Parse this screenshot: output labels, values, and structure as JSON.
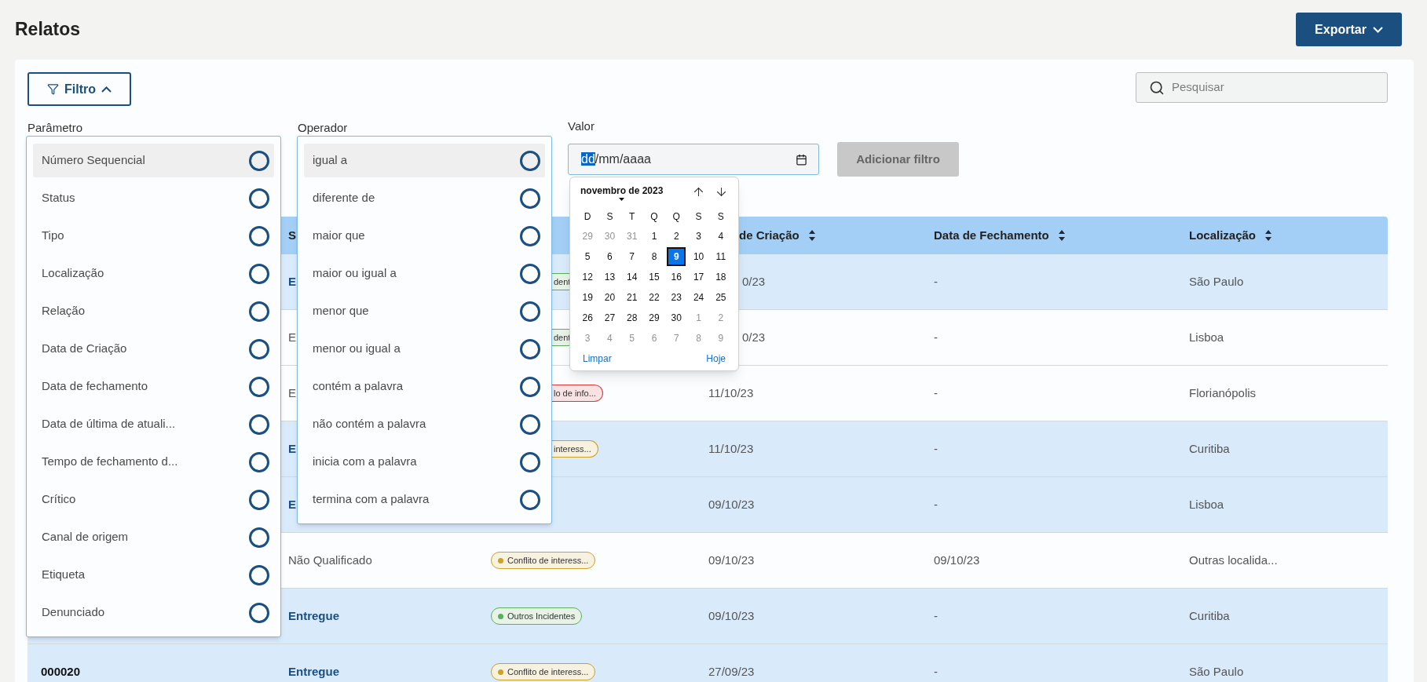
{
  "page": {
    "title": "Relatos"
  },
  "export_button": {
    "label": "Exportar"
  },
  "filter_button": {
    "label": "Filtro",
    "expanded": true
  },
  "search": {
    "placeholder": "Pesquisar"
  },
  "filter_form": {
    "parameter_label": "Parâmetro",
    "operator_label": "Operador",
    "value_label": "Valor",
    "value_segments": [
      {
        "text": "dd",
        "selected": true
      },
      {
        "text": "/mm/aaaa",
        "selected": false
      }
    ],
    "add_button": {
      "label": "Adicionar filtro",
      "disabled": true
    }
  },
  "parameter_menu": [
    {
      "label": "Número Sequencial",
      "highlighted": true,
      "selected": false
    },
    {
      "label": "Status",
      "highlighted": false,
      "selected": false
    },
    {
      "label": "Tipo",
      "highlighted": false,
      "selected": false
    },
    {
      "label": "Localização",
      "highlighted": false,
      "selected": false
    },
    {
      "label": "Relação",
      "highlighted": false,
      "selected": false
    },
    {
      "label": "Data de Criação",
      "highlighted": false,
      "selected": false
    },
    {
      "label": "Data de fechamento",
      "highlighted": false,
      "selected": false
    },
    {
      "label": "Data de última de atuali...",
      "highlighted": false,
      "selected": false
    },
    {
      "label": "Tempo de fechamento d...",
      "highlighted": false,
      "selected": false
    },
    {
      "label": "Crítico",
      "highlighted": false,
      "selected": false
    },
    {
      "label": "Canal de origem",
      "highlighted": false,
      "selected": false
    },
    {
      "label": "Etiqueta",
      "highlighted": false,
      "selected": false
    },
    {
      "label": "Denunciado",
      "highlighted": false,
      "selected": false
    }
  ],
  "operator_menu": [
    {
      "label": "igual a",
      "highlighted": true,
      "selected": false
    },
    {
      "label": "diferente de",
      "highlighted": false,
      "selected": false
    },
    {
      "label": "maior que",
      "highlighted": false,
      "selected": false
    },
    {
      "label": "maior ou igual a",
      "highlighted": false,
      "selected": false
    },
    {
      "label": "menor que",
      "highlighted": false,
      "selected": false
    },
    {
      "label": "menor ou igual a",
      "highlighted": false,
      "selected": false
    },
    {
      "label": "contém a palavra",
      "highlighted": false,
      "selected": false
    },
    {
      "label": "não contém a palavra",
      "highlighted": false,
      "selected": false
    },
    {
      "label": "inicia com a palavra",
      "highlighted": false,
      "selected": false
    },
    {
      "label": "termina com a palavra",
      "highlighted": false,
      "selected": false
    }
  ],
  "date_picker": {
    "month_label": "novembro de 2023",
    "weekdays": [
      "D",
      "S",
      "T",
      "Q",
      "Q",
      "S",
      "S"
    ],
    "weeks": [
      [
        {
          "day": "29",
          "outside_month": true,
          "selected": false
        },
        {
          "day": "30",
          "outside_month": true,
          "selected": false
        },
        {
          "day": "31",
          "outside_month": true,
          "selected": false
        },
        {
          "day": "1",
          "outside_month": false,
          "selected": false
        },
        {
          "day": "2",
          "outside_month": false,
          "selected": false
        },
        {
          "day": "3",
          "outside_month": false,
          "selected": false
        },
        {
          "day": "4",
          "outside_month": false,
          "selected": false
        }
      ],
      [
        {
          "day": "5",
          "outside_month": false,
          "selected": false
        },
        {
          "day": "6",
          "outside_month": false,
          "selected": false
        },
        {
          "day": "7",
          "outside_month": false,
          "selected": false
        },
        {
          "day": "8",
          "outside_month": false,
          "selected": false
        },
        {
          "day": "9",
          "outside_month": false,
          "selected": true
        },
        {
          "day": "10",
          "outside_month": false,
          "selected": false
        },
        {
          "day": "11",
          "outside_month": false,
          "selected": false
        }
      ],
      [
        {
          "day": "12",
          "outside_month": false,
          "selected": false
        },
        {
          "day": "13",
          "outside_month": false,
          "selected": false
        },
        {
          "day": "14",
          "outside_month": false,
          "selected": false
        },
        {
          "day": "15",
          "outside_month": false,
          "selected": false
        },
        {
          "day": "16",
          "outside_month": false,
          "selected": false
        },
        {
          "day": "17",
          "outside_month": false,
          "selected": false
        },
        {
          "day": "18",
          "outside_month": false,
          "selected": false
        }
      ],
      [
        {
          "day": "19",
          "outside_month": false,
          "selected": false
        },
        {
          "day": "20",
          "outside_month": false,
          "selected": false
        },
        {
          "day": "21",
          "outside_month": false,
          "selected": false
        },
        {
          "day": "22",
          "outside_month": false,
          "selected": false
        },
        {
          "day": "23",
          "outside_month": false,
          "selected": false
        },
        {
          "day": "24",
          "outside_month": false,
          "selected": false
        },
        {
          "day": "25",
          "outside_month": false,
          "selected": false
        }
      ],
      [
        {
          "day": "26",
          "outside_month": false,
          "selected": false
        },
        {
          "day": "27",
          "outside_month": false,
          "selected": false
        },
        {
          "day": "28",
          "outside_month": false,
          "selected": false
        },
        {
          "day": "29",
          "outside_month": false,
          "selected": false
        },
        {
          "day": "30",
          "outside_month": false,
          "selected": false
        },
        {
          "day": "1",
          "outside_month": true,
          "selected": false
        },
        {
          "day": "2",
          "outside_month": true,
          "selected": false
        }
      ],
      [
        {
          "day": "3",
          "outside_month": true,
          "selected": false
        },
        {
          "day": "4",
          "outside_month": true,
          "selected": false
        },
        {
          "day": "5",
          "outside_month": true,
          "selected": false
        },
        {
          "day": "6",
          "outside_month": true,
          "selected": false
        },
        {
          "day": "7",
          "outside_month": true,
          "selected": false
        },
        {
          "day": "8",
          "outside_month": true,
          "selected": false
        },
        {
          "day": "9",
          "outside_month": true,
          "selected": false
        }
      ]
    ],
    "clear": "Limpar",
    "today": "Hoje"
  },
  "table": {
    "columns": [
      null,
      {
        "label": "S",
        "sortable": false,
        "partial": false
      },
      null,
      {
        "label": "de Criação",
        "sortable": true,
        "partial": true
      },
      {
        "label": "Data de Fechamento",
        "sortable": true,
        "partial": false
      },
      {
        "label": "Localização",
        "sortable": true,
        "partial": false
      }
    ],
    "rows": [
      {
        "unread": true,
        "cells": [
          null,
          {
            "text": "E"
          },
          {
            "tag": {
              "text": "dent",
              "color": "#5cae5c",
              "partial": true
            }
          },
          {
            "text": "0/23",
            "partial": true
          },
          {
            "text": "-"
          },
          {
            "text": "São Paulo"
          }
        ]
      },
      {
        "unread": false,
        "cells": [
          null,
          {
            "text": "E"
          },
          {
            "tag": {
              "text": "dent",
              "color": "#5cae5c",
              "partial": true
            }
          },
          {
            "text": "0/23",
            "partial": true
          },
          {
            "text": "-"
          },
          {
            "text": "Lisboa"
          }
        ]
      },
      {
        "unread": false,
        "cells": [
          null,
          {
            "text": "E"
          },
          {
            "tag": {
              "text": "lo de info...",
              "color": "#d33b3b",
              "partial": true
            }
          },
          {
            "text": "11/10/23"
          },
          {
            "text": "-"
          },
          {
            "text": "Florianópolis"
          }
        ]
      },
      {
        "unread": true,
        "cells": [
          null,
          {
            "text": "E"
          },
          {
            "tag": {
              "text": "interess...",
              "color": "#c9a227",
              "partial": true
            }
          },
          {
            "text": "11/10/23"
          },
          {
            "text": "-"
          },
          {
            "text": "Curitiba"
          }
        ]
      },
      {
        "unread": true,
        "cells": [
          null,
          {
            "text": "E"
          },
          null,
          {
            "text": "09/10/23"
          },
          {
            "text": "-"
          },
          {
            "text": "Lisboa"
          }
        ]
      },
      {
        "unread": false,
        "cells": [
          null,
          {
            "text": "Não Qualificado"
          },
          {
            "tag": {
              "text": "Conflito de interess...",
              "color": "#c9a227",
              "partial": false
            }
          },
          {
            "text": "09/10/23"
          },
          {
            "text": "09/10/23"
          },
          {
            "text": "Outras localida..."
          }
        ]
      },
      {
        "unread": true,
        "cells": [
          null,
          {
            "text": "Entregue"
          },
          {
            "tag": {
              "text": "Outros Incidentes",
              "color": "#5cae5c",
              "partial": false
            }
          },
          {
            "text": "09/10/23"
          },
          {
            "text": "-"
          },
          {
            "text": "Curitiba"
          }
        ]
      },
      {
        "unread": true,
        "cells": [
          {
            "text": "000020"
          },
          {
            "text": "Entregue"
          },
          {
            "tag": {
              "text": "Conflito de interess...",
              "color": "#c9a227",
              "partial": false
            }
          },
          {
            "text": "27/09/23"
          },
          {
            "text": "-"
          },
          {
            "text": "São Paulo"
          }
        ]
      }
    ]
  }
}
